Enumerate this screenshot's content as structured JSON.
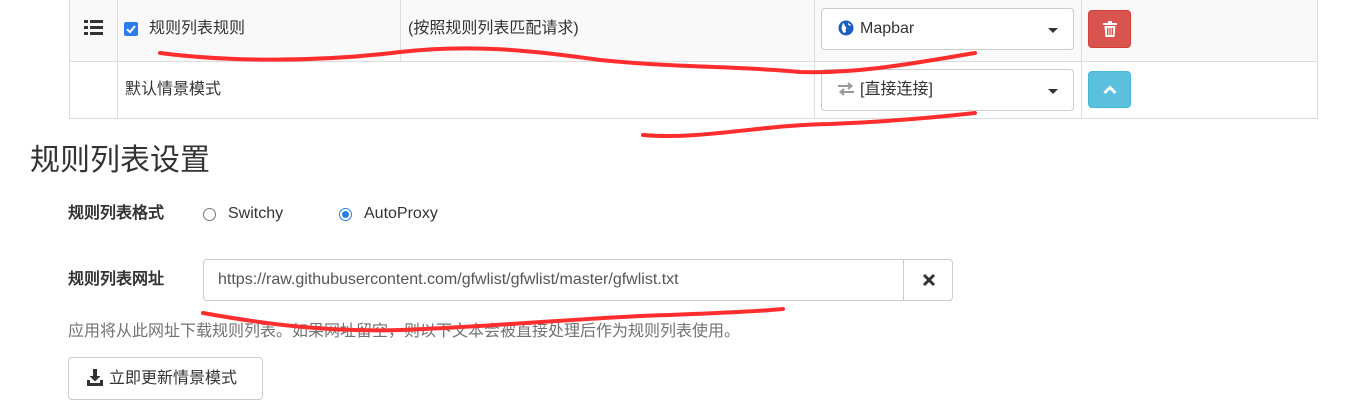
{
  "rules_table": {
    "rule_row": {
      "condition_label": "规则列表规则",
      "condition_detail": "(按照规则列表匹配请求)",
      "profile_select_value": "Mapbar",
      "checked": true
    },
    "default_row": {
      "label": "默认情景模式",
      "profile_select_value": "[直接连接]"
    }
  },
  "section": {
    "title": "规则列表设置",
    "format_label": "规则列表格式",
    "format_options": [
      {
        "label": "Switchy",
        "selected": false
      },
      {
        "label": "AutoProxy",
        "selected": true
      }
    ],
    "url_label": "规则列表网址",
    "url_value": "https://raw.githubusercontent.com/gfwlist/gfwlist/master/gfwlist.txt",
    "help_text": "应用将从此网址下载规则列表。如果网址留空，则以下文本会被直接处理后作为规则列表使用。",
    "update_button_label": "立即更新情景模式"
  },
  "colors": {
    "danger": "#d9534f",
    "info": "#5bc0de",
    "checkbox": "#2b7de9",
    "annotation": "#ff2d2d"
  },
  "icons": {
    "reorder": "list-icon",
    "globe": "globe-icon",
    "direct": "exchange-arrows-icon",
    "delete": "trash-icon",
    "collapse": "chevron-up-icon",
    "clear": "close-icon",
    "download": "download-icon"
  }
}
